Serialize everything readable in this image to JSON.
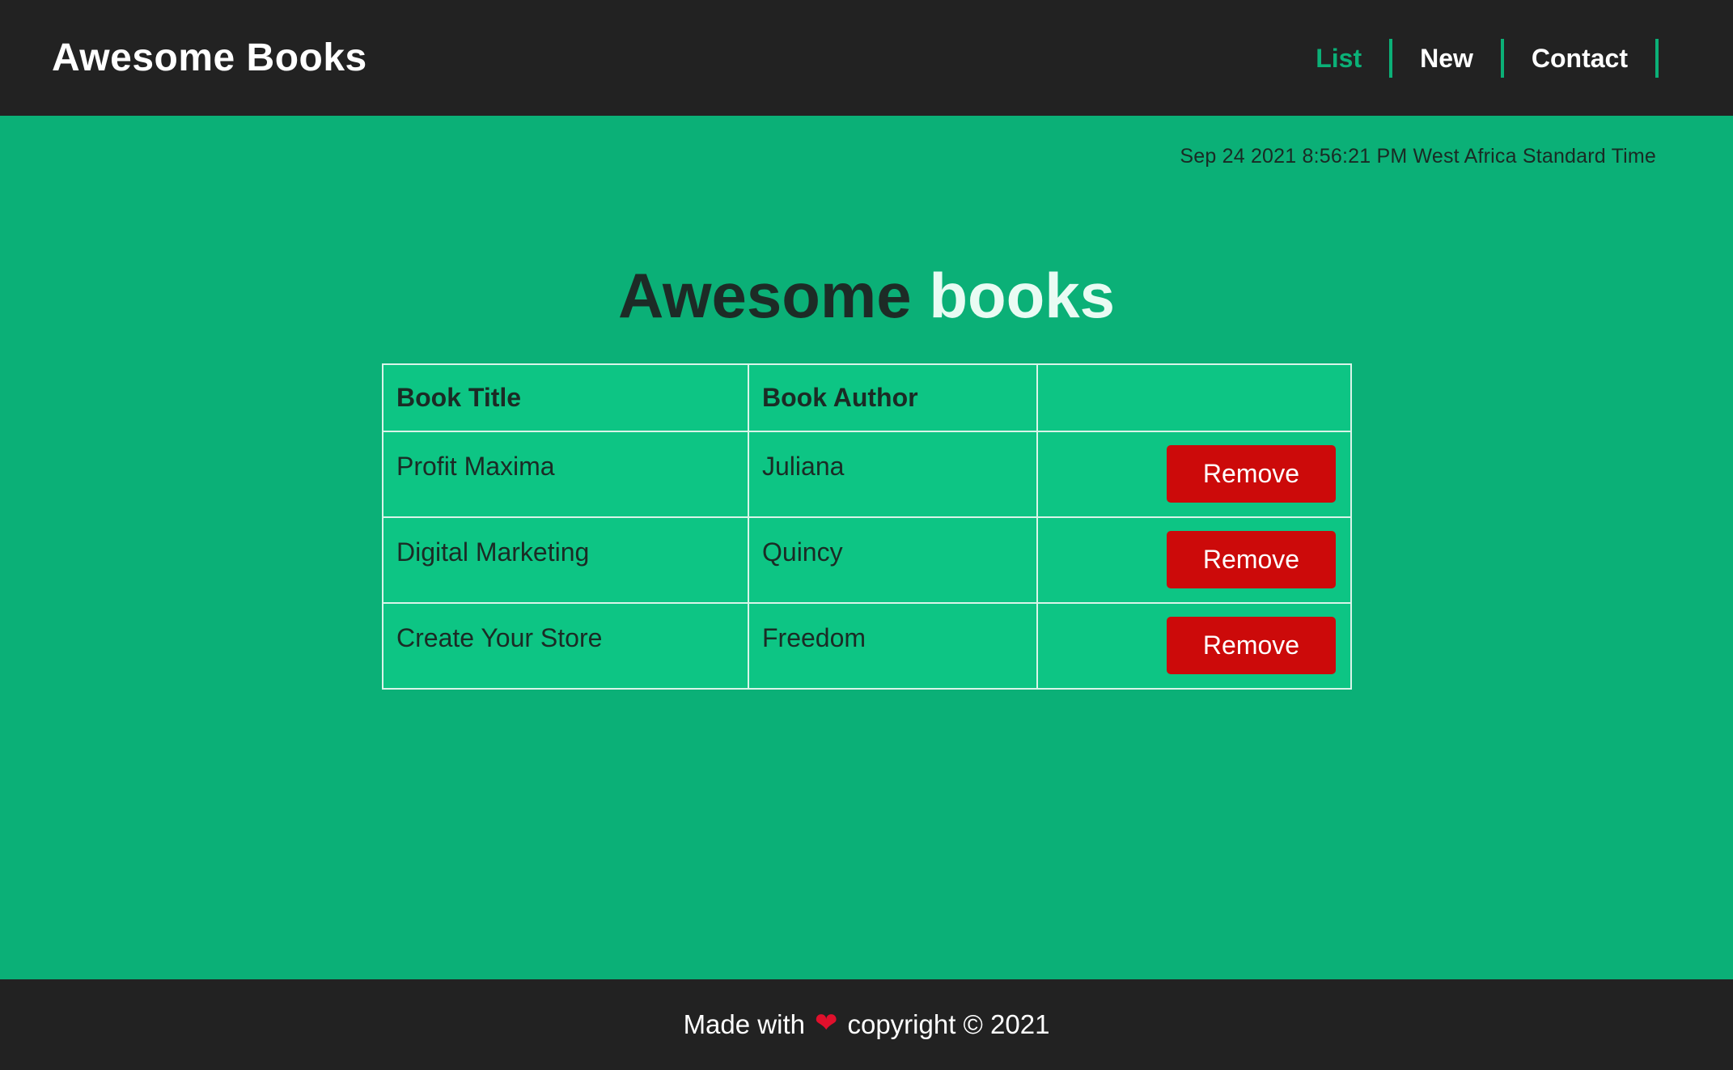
{
  "header": {
    "brand": "Awesome Books",
    "nav": [
      {
        "label": "List",
        "active": true
      },
      {
        "label": "New",
        "active": false
      },
      {
        "label": "Contact",
        "active": false
      }
    ]
  },
  "datetime": "Sep 24 2021 8:56:21 PM West Africa Standard Time",
  "main": {
    "heading_dark": "Awesome",
    "heading_light": "books",
    "table": {
      "columns": [
        "Book Title",
        "Book Author",
        ""
      ],
      "rows": [
        {
          "title": "Profit Maxima",
          "author": "Juliana",
          "action": "Remove"
        },
        {
          "title": "Digital Marketing",
          "author": "Quincy",
          "action": "Remove"
        },
        {
          "title": "Create Your Store",
          "author": "Freedom",
          "action": "Remove"
        }
      ]
    }
  },
  "footer": {
    "text_before": "Made with",
    "icon": "heart-icon",
    "text_after": "copyright © 2021"
  },
  "colors": {
    "accent": "#0bb077",
    "navbar": "#222222",
    "table_bg": "#0dc584",
    "remove_button": "#cc0a0a"
  }
}
